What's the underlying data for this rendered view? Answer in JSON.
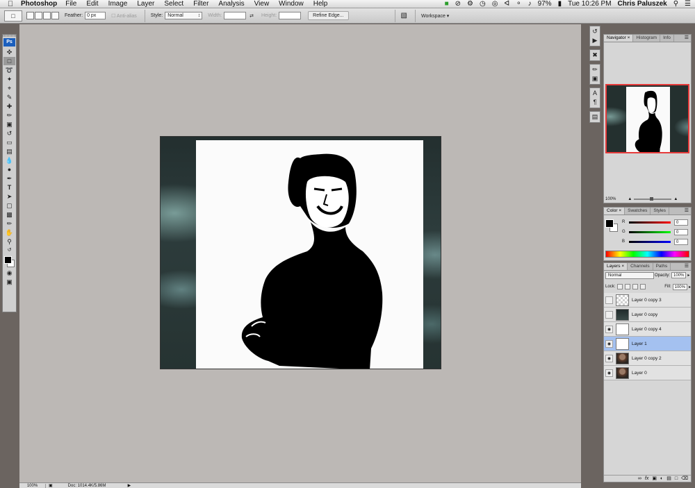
{
  "menubar": {
    "app_name": "Photoshop",
    "menus": [
      "File",
      "Edit",
      "Image",
      "Layer",
      "Select",
      "Filter",
      "Analysis",
      "View",
      "Window",
      "Help"
    ],
    "battery": "97%",
    "clock": "Tue 10:26 PM",
    "user": "Chris Paluszek"
  },
  "options": {
    "feather_label": "Feather:",
    "feather_value": "0 px",
    "antialias_label": "Anti-alias",
    "style_label": "Style:",
    "style_value": "Normal",
    "width_label": "Width:",
    "height_label": "Height:",
    "refine_edge": "Refine Edge...",
    "workspace_label": "Workspace ▾"
  },
  "toolbox": {
    "ps_label": "Ps",
    "tools": [
      "move",
      "marquee",
      "lasso",
      "magic-wand",
      "crop",
      "slice",
      "healing",
      "brush",
      "stamp",
      "history-brush",
      "eraser",
      "gradient",
      "blur",
      "dodge",
      "pen",
      "type",
      "path-select",
      "shape",
      "notes",
      "eyedropper",
      "hand",
      "zoom"
    ],
    "foreground_color": "#000000",
    "background_color": "#ffffff"
  },
  "status": {
    "zoom": "100%",
    "doc_info": "Doc: 1014.4K/5.86M"
  },
  "navigator": {
    "tabs": [
      "Navigator",
      "Histogram",
      "Info"
    ],
    "zoom": "100%"
  },
  "color_panel": {
    "tabs": [
      "Color",
      "Swatches",
      "Styles"
    ],
    "r_label": "R",
    "g_label": "G",
    "b_label": "B",
    "r_value": "0",
    "g_value": "0",
    "b_value": "0"
  },
  "layers_panel": {
    "tabs": [
      "Layers",
      "Channels",
      "Paths"
    ],
    "blend_mode": "Normal",
    "opacity_label": "Opacity:",
    "opacity_value": "100%",
    "lock_label": "Lock:",
    "fill_label": "Fill:",
    "fill_value": "100%",
    "layers": [
      {
        "name": "Layer 0 copy 3",
        "visible": false,
        "selected": false
      },
      {
        "name": "Layer 0 copy",
        "visible": false,
        "selected": false
      },
      {
        "name": "Layer 0 copy 4",
        "visible": true,
        "selected": false
      },
      {
        "name": "Layer 1",
        "visible": true,
        "selected": true
      },
      {
        "name": "Layer 0 copy 2",
        "visible": true,
        "selected": false
      },
      {
        "name": "Layer 0",
        "visible": true,
        "selected": false
      }
    ]
  }
}
